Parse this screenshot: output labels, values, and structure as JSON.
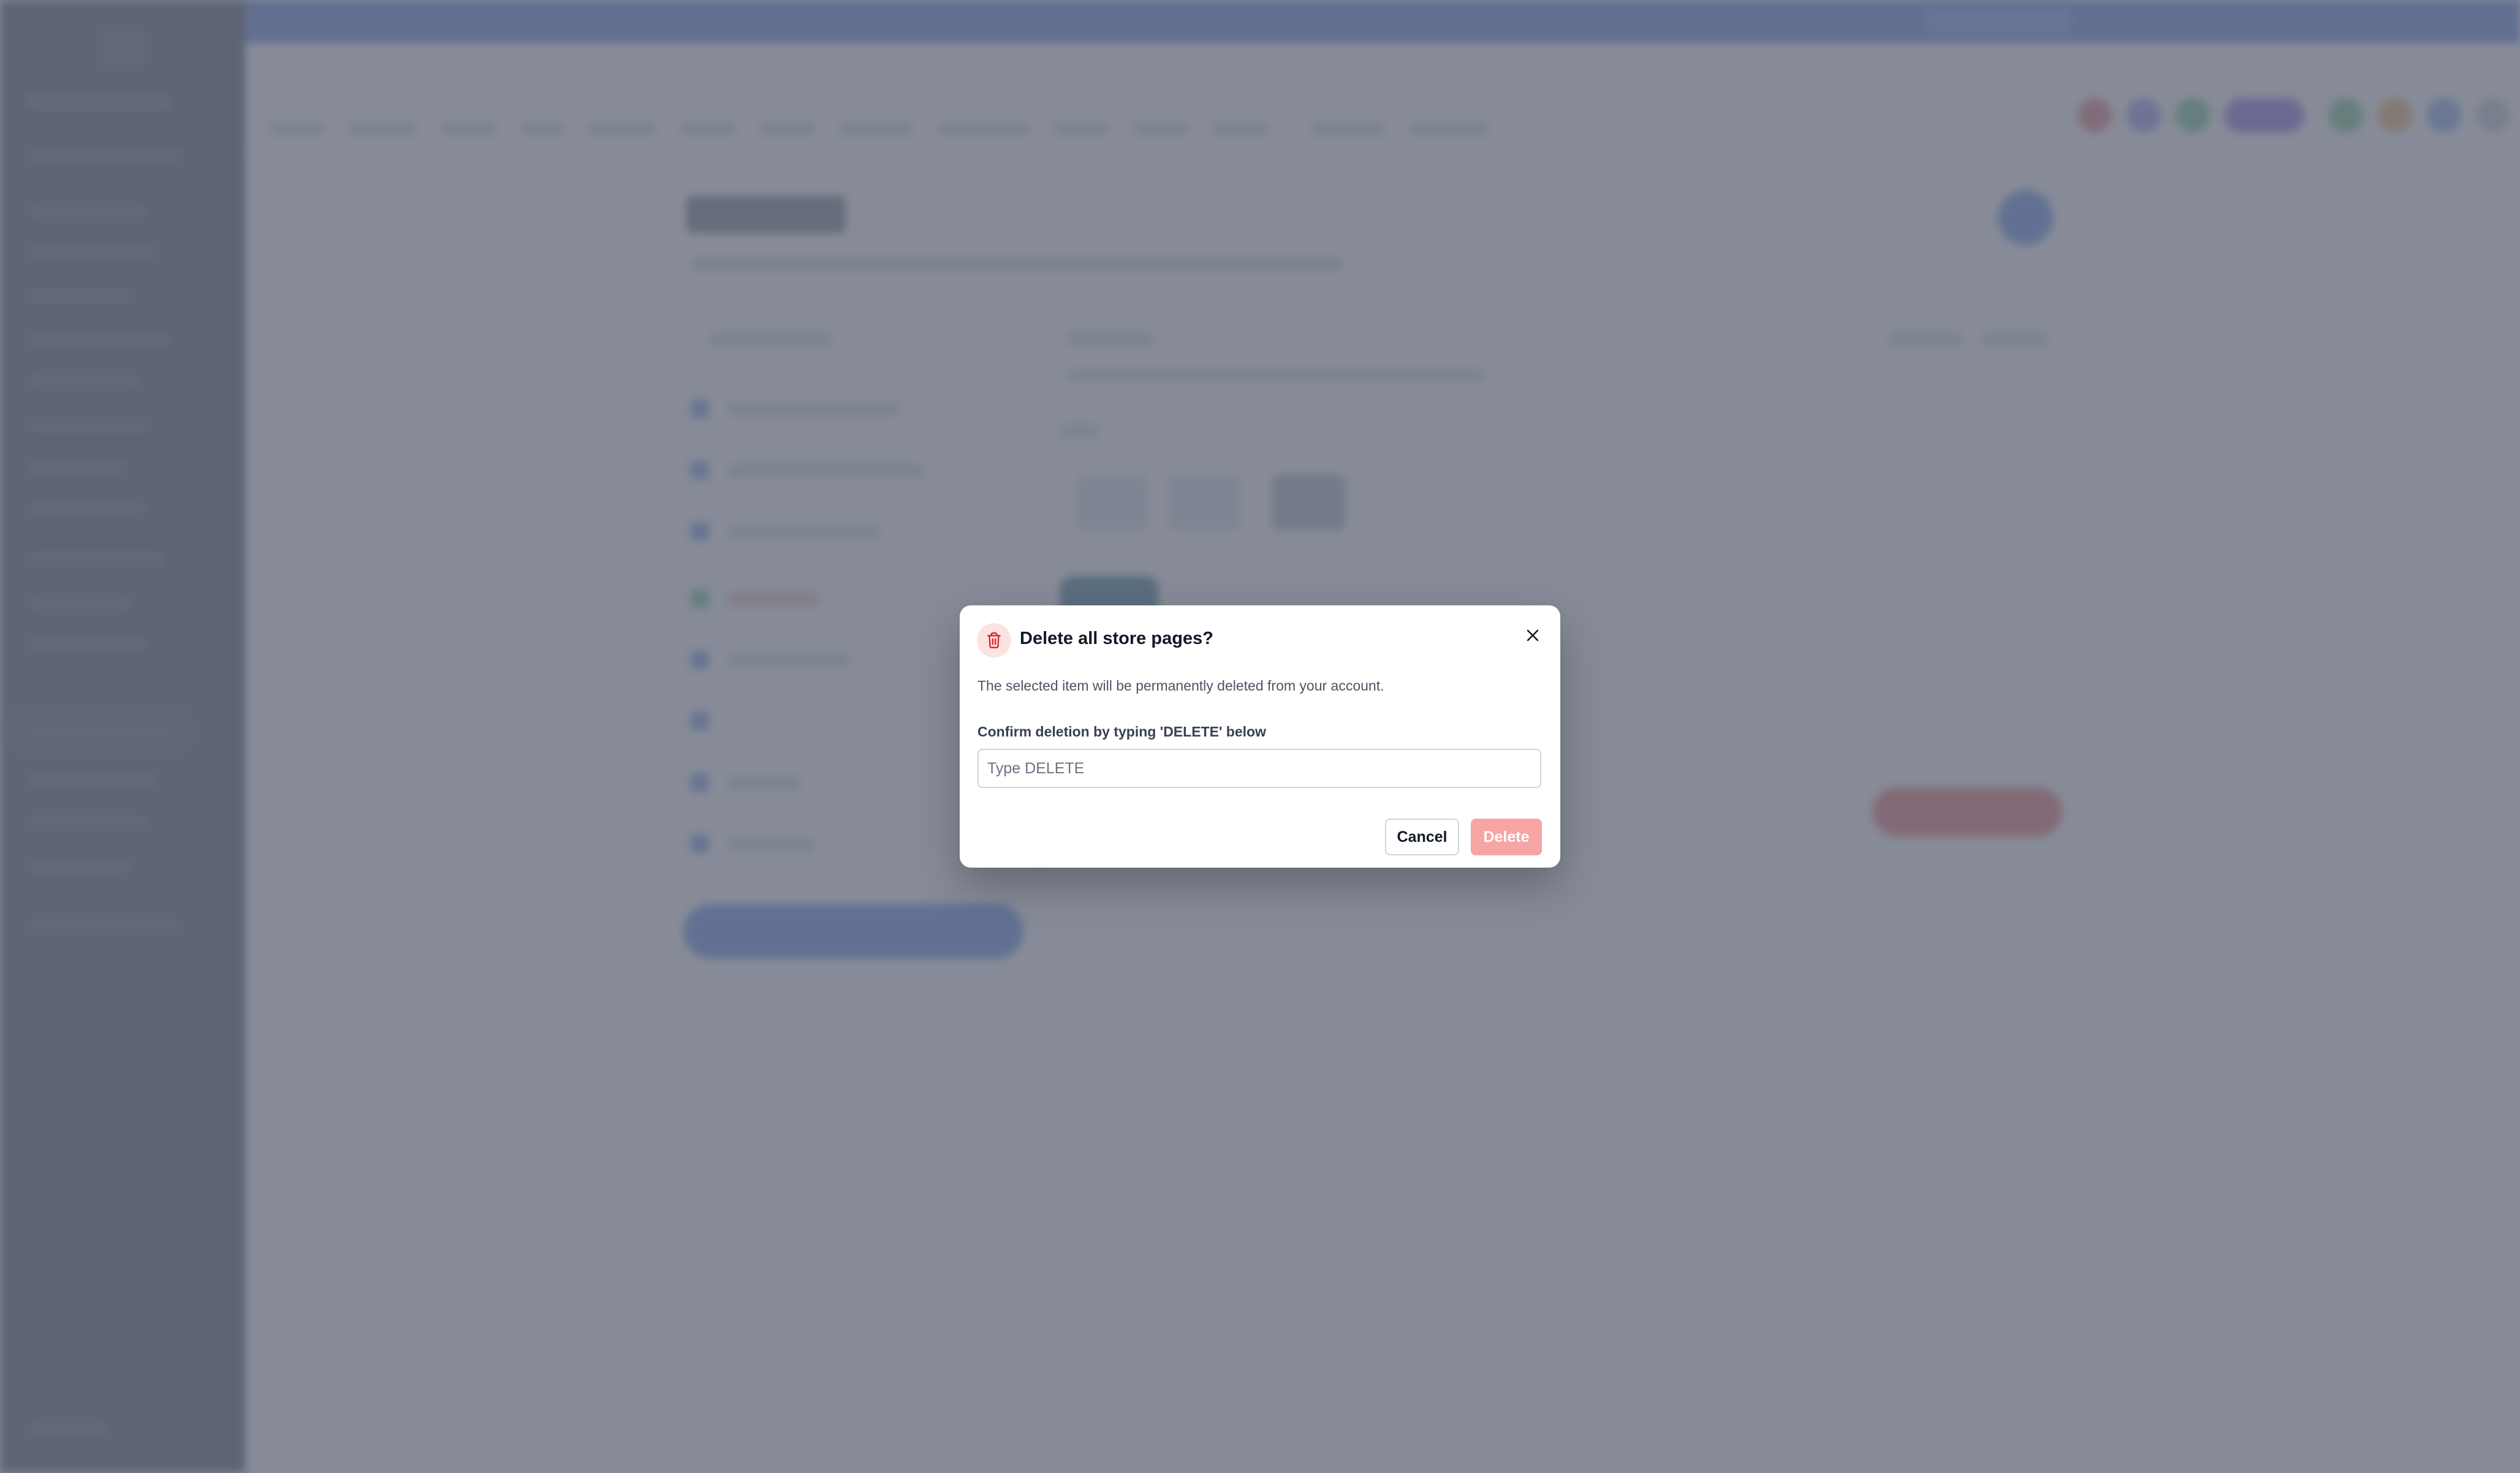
{
  "modal": {
    "title": "Delete all store pages?",
    "description": "The selected item will be permanently deleted from your account.",
    "field_label": "Confirm deletion by typing 'DELETE' below",
    "input_value": "",
    "input_placeholder": "Type DELETE",
    "cancel_label": "Cancel",
    "delete_label": "Delete",
    "delete_disabled": true,
    "icons": {
      "header": "trash-icon",
      "close": "close-icon"
    }
  },
  "colors": {
    "overlay": "#6b7280",
    "danger": "#dc2626",
    "danger_disabled": "#f6a4a4",
    "danger_icon_bg": "#fde2e2",
    "sidebar": "#1e2b45",
    "primary": "#3b6fe8"
  }
}
